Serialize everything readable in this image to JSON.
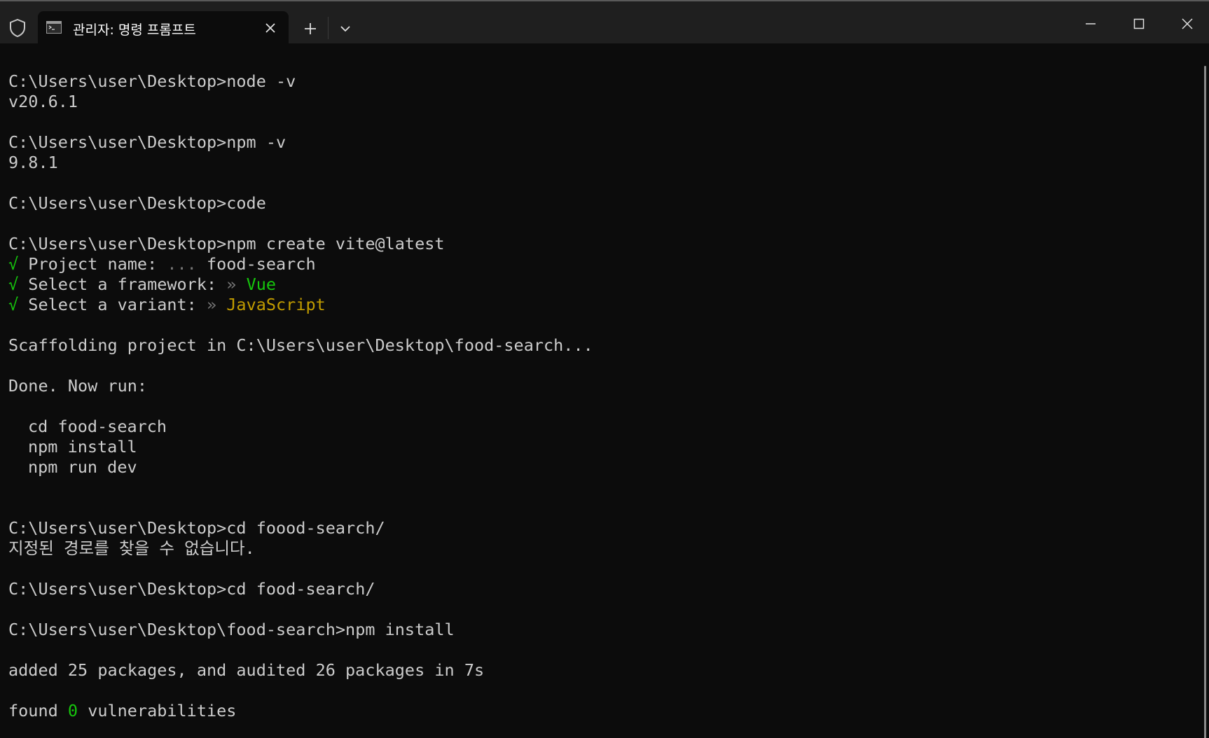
{
  "window": {
    "tab_title": "관리자: 명령 프롬프트"
  },
  "icons": {
    "shield": "shield-icon",
    "terminal": "terminal-icon",
    "close_tab": "close-icon",
    "new_tab": "plus-icon",
    "dropdown": "chevron-down-icon",
    "minimize": "minimize-icon",
    "maximize": "maximize-icon",
    "close_window": "close-icon"
  },
  "colors": {
    "background": "#0c0c0c",
    "text": "#cccccc",
    "green": "#16c60c",
    "yellow": "#c19c00",
    "titlebar": "#1f1f1f"
  },
  "terminal": {
    "prompt_desktop": "C:\\Users\\user\\Desktop>",
    "prompt_project": "C:\\Users\\user\\Desktop\\food-search>",
    "cmd_node": "node -v",
    "out_node": "v20.6.1",
    "cmd_npm": "npm -v",
    "out_npm": "9.8.1",
    "cmd_code": "code",
    "cmd_create": "npm create vite@latest",
    "check": "√",
    "q_project_name": " Project name: ",
    "q_project_dots": "...",
    "a_project_name": " food-search",
    "q_framework": " Select a framework: ",
    "q_arrow": "»",
    "a_framework": " Vue",
    "q_variant": " Select a variant: ",
    "a_variant": " JavaScript",
    "scaffolding": "Scaffolding project in C:\\Users\\user\\Desktop\\food-search...",
    "done": "Done. Now run:",
    "step_cd": "cd food-search",
    "step_install": "npm install",
    "step_dev": "npm run dev",
    "cmd_cd_wrong": "cd foood-search/",
    "err_path": "지정된 경로를 찾을 수 없습니다.",
    "cmd_cd": "cd food-search/",
    "cmd_install": "npm install",
    "added": "added 25 packages, and audited 26 packages in 7s",
    "found_prefix": "found ",
    "found_count": "0",
    "found_suffix": " vulnerabilities"
  }
}
